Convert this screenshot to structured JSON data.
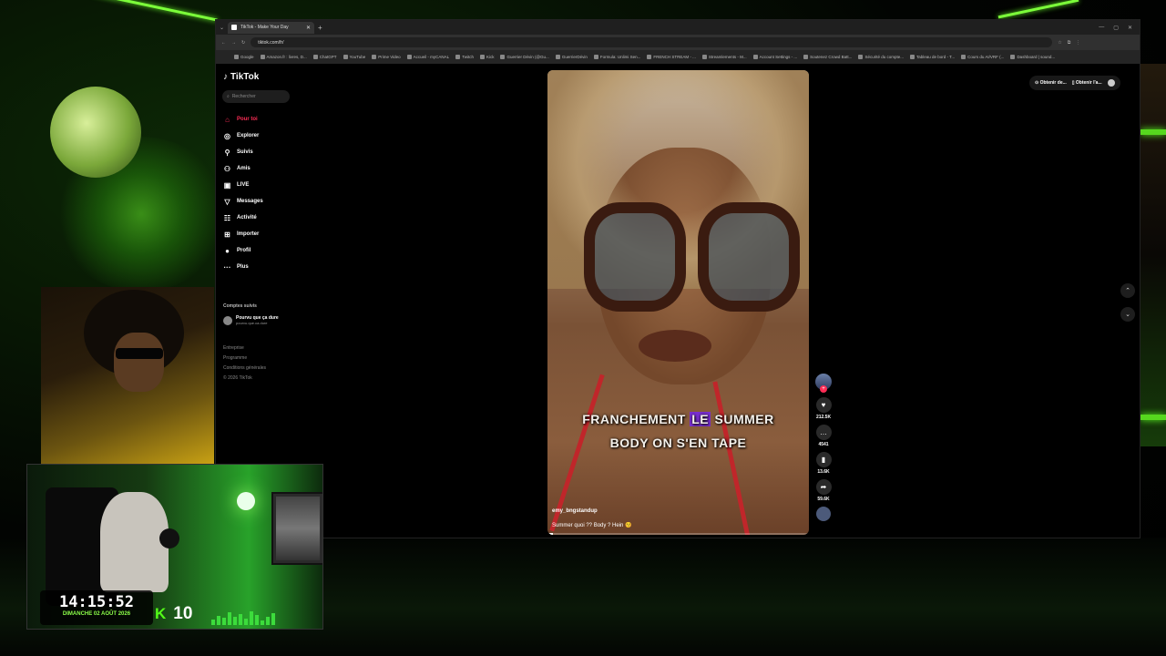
{
  "browser": {
    "tab_title": "TikTok - Make Your Day",
    "url": "tiktok.com/fr/",
    "bookmarks": [
      "Google",
      "Amazon.fr : livres, D...",
      "ChatGPT",
      "YouTube",
      "Prime Video",
      "Accueil - myCANAL",
      "Twitch",
      "Kick",
      "Guerrier Dévin (@Gu...",
      "GuerrierDévin",
      "Formula: Unlimi Sen...",
      "FRENCH STREAM - ...",
      "Streamlements - M...",
      "Account Settings - ...",
      "Soutenez Crowd Batt...",
      "Sécurité du compte...",
      "Tableau de bord - T...",
      "Cours du AI/VRF (...",
      "Dashboard | sound..."
    ]
  },
  "tiktok": {
    "logo": "TikTok",
    "search_placeholder": "Rechercher",
    "nav": [
      {
        "label": "Pour toi",
        "icon": "home-icon",
        "glyph": "⌂",
        "active": true
      },
      {
        "label": "Explorer",
        "icon": "compass-icon",
        "glyph": "◎",
        "active": false
      },
      {
        "label": "Suivis",
        "icon": "user-follow-icon",
        "glyph": "⚲",
        "active": false
      },
      {
        "label": "Amis",
        "icon": "friends-icon",
        "glyph": "⚇",
        "active": false
      },
      {
        "label": "LIVE",
        "icon": "live-icon",
        "glyph": "▣",
        "active": false
      },
      {
        "label": "Messages",
        "icon": "messages-icon",
        "glyph": "▽",
        "active": false
      },
      {
        "label": "Activité",
        "icon": "activity-icon",
        "glyph": "☷",
        "active": false
      },
      {
        "label": "Importer",
        "icon": "upload-icon",
        "glyph": "⊞",
        "active": false
      },
      {
        "label": "Profil",
        "icon": "profile-icon",
        "glyph": "●",
        "active": false
      },
      {
        "label": "Plus",
        "icon": "more-icon",
        "glyph": "···",
        "active": false
      }
    ],
    "followed_label": "Comptes suivis",
    "followed": [
      {
        "name": "Pourvu que ça dure",
        "handle": "pourvu.que.ca.dure"
      }
    ],
    "footer": [
      "Entreprise",
      "Programme",
      "Conditions générales",
      "© 2026 TikTok"
    ],
    "get_app": "Obtenir de...",
    "get_app2": "Obtenir l'a...",
    "video": {
      "subtitle_line1_a": "FRANCHEMENT ",
      "subtitle_line1_hl": "LE",
      "subtitle_line1_b": " SUMMER",
      "subtitle_line2": "BODY ON S'EN TAPE",
      "username": "emy_bngstandup",
      "description": "Summer quoi ?? Body ? Hein 😚",
      "progress": 0.02
    },
    "actions": {
      "likes": "212.5K",
      "comments": "4541",
      "saves": "13.6K",
      "shares": "59.6K"
    }
  },
  "stream": {
    "time": "14:15:52",
    "date": "DIMANCHE 02 AOÛT 2026",
    "kick_letter": "K",
    "viewers": "10"
  }
}
